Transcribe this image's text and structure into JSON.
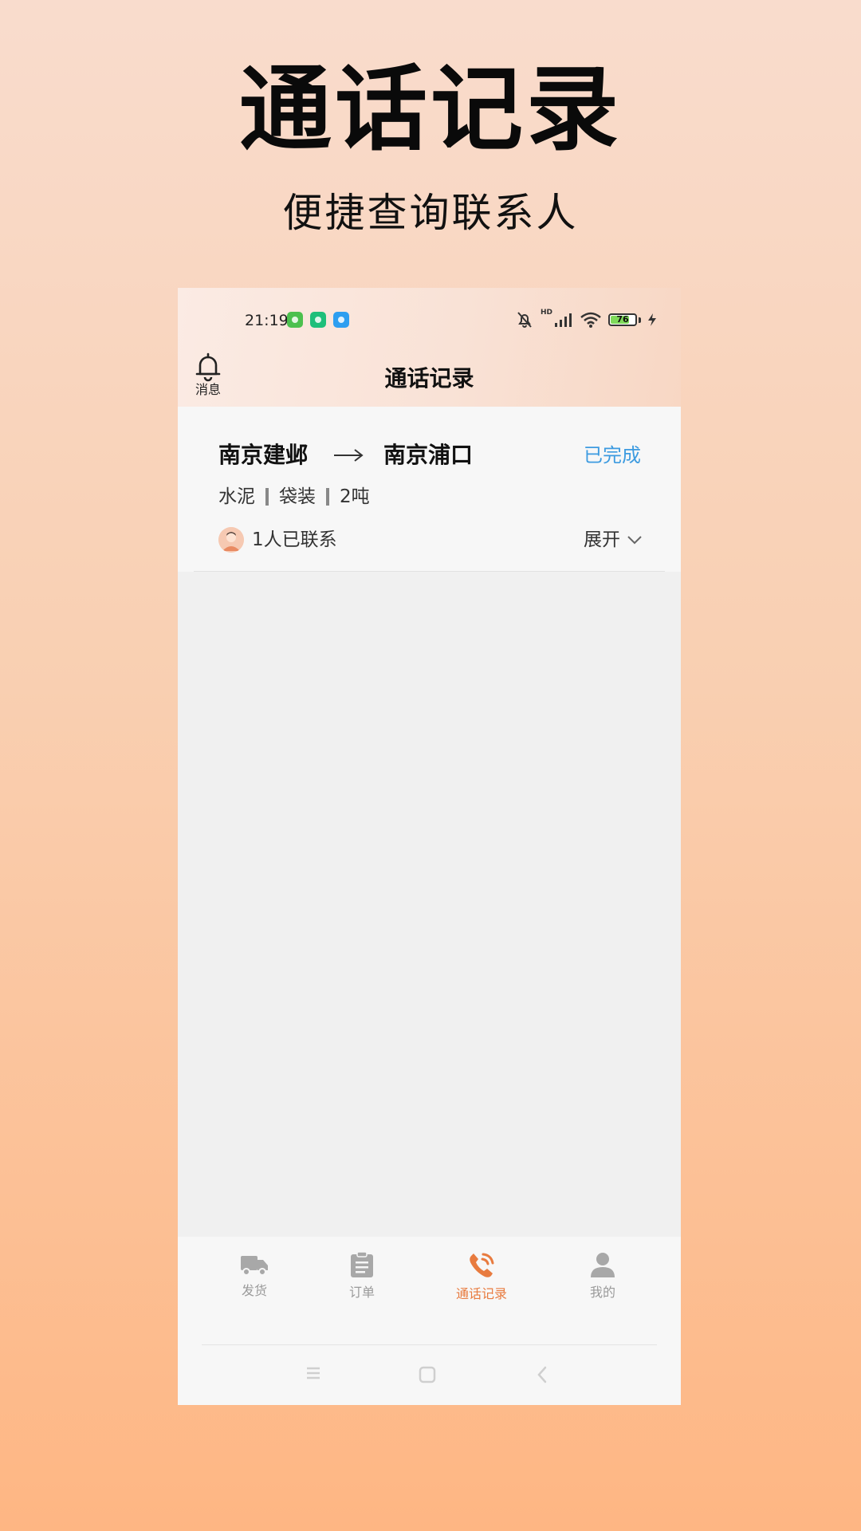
{
  "promo": {
    "title": "通话记录",
    "subtitle": "便捷查询联系人"
  },
  "status_bar": {
    "time": "21:19",
    "network_label": "HD",
    "battery_level": "76",
    "battery_fraction": 0.76
  },
  "nav": {
    "messages_label": "消息",
    "title": "通话记录"
  },
  "order": {
    "from": "南京建邺",
    "to": "南京浦口",
    "status": "已完成",
    "cargo": [
      "水泥",
      "袋装",
      "2吨"
    ],
    "contacts_text": "1人已联系",
    "expand_label": "展开"
  },
  "tabbar": {
    "items": [
      {
        "label": "发货",
        "icon": "truck-icon",
        "active": false
      },
      {
        "label": "订单",
        "icon": "clipboard-icon",
        "active": false
      },
      {
        "label": "通话记录",
        "icon": "phone-icon",
        "active": true
      },
      {
        "label": "我的",
        "icon": "person-icon",
        "active": false
      }
    ]
  },
  "colors": {
    "accent_active": "#e87b3f",
    "status_done": "#3d9be0",
    "tab_inactive": "#9a9a9a"
  }
}
